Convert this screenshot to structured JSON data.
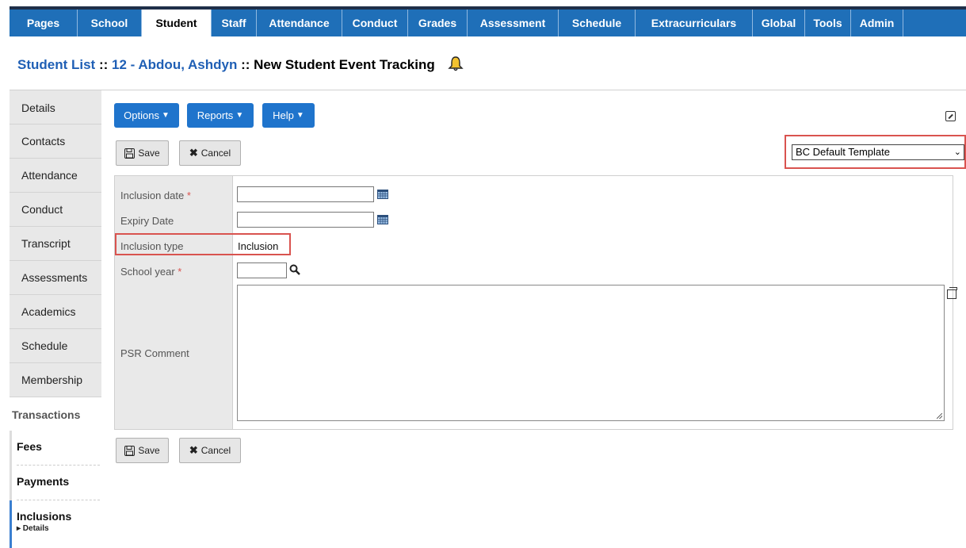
{
  "tabs": [
    {
      "label": "Pages"
    },
    {
      "label": "School"
    },
    {
      "label": "Student",
      "active": true
    },
    {
      "label": "Staff"
    },
    {
      "label": "Attendance"
    },
    {
      "label": "Conduct"
    },
    {
      "label": "Grades"
    },
    {
      "label": "Assessment"
    },
    {
      "label": "Schedule"
    },
    {
      "label": "Extracurriculars"
    },
    {
      "label": "Global"
    },
    {
      "label": "Tools"
    },
    {
      "label": "Admin"
    }
  ],
  "breadcrumb": {
    "student_list": "Student List",
    "sep1": " :: ",
    "student": "12 - Abdou, Ashdyn",
    "sep2": " :: ",
    "page": "New Student Event Tracking",
    "icon": "bell-icon"
  },
  "sidebar": {
    "items": [
      "Details",
      "Contacts",
      "Attendance",
      "Conduct",
      "Transcript",
      "Assessments",
      "Academics",
      "Schedule",
      "Membership"
    ],
    "section": "Transactions",
    "transactions": [
      "Fees",
      "Payments",
      "Inclusions"
    ],
    "sub_item": "▸ Details"
  },
  "toolbar": {
    "options": "Options",
    "reports": "Reports",
    "help": "Help",
    "save": "Save",
    "cancel": "Cancel"
  },
  "template": {
    "selected": "BC Default Template"
  },
  "form": {
    "inclusion_date_label": "Inclusion date",
    "expiry_date_label": "Expiry Date",
    "inclusion_type_label": "Inclusion type",
    "inclusion_type_value": "Inclusion",
    "school_year_label": "School year",
    "psr_comment_label": "PSR Comment",
    "required_mark": "*",
    "inclusion_date": "",
    "expiry_date": "",
    "school_year": "",
    "psr_comment": ""
  },
  "colors": {
    "tab_bar": "#1f6fb8",
    "button": "#1f74cc",
    "highlight": "#d9534f",
    "required": "#d9534f"
  }
}
